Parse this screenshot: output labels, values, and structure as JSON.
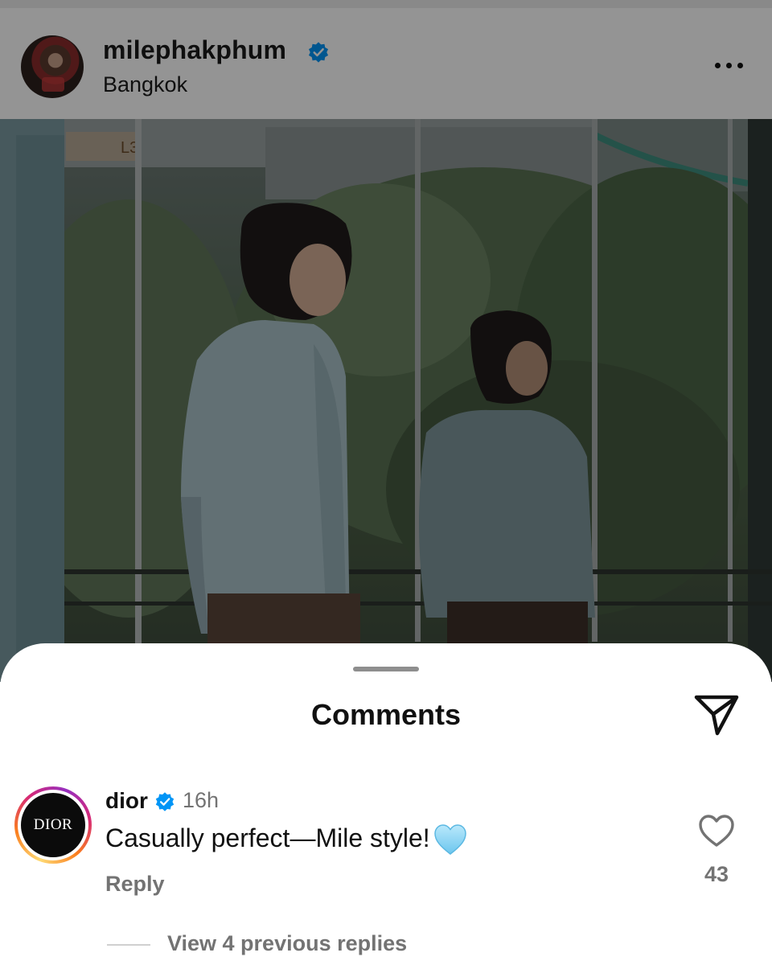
{
  "post": {
    "username": "milephakphum",
    "location": "Bangkok",
    "verified_icon": "verified-badge-icon",
    "more_icon": "more-options-icon",
    "floor_sign": "L3"
  },
  "comments_sheet": {
    "title": "Comments",
    "share_icon": "paper-plane-icon",
    "comments": [
      {
        "username": "dior",
        "avatar_text": "DIOR",
        "time": "16h",
        "text": "Casually perfect—Mile style!",
        "emoji_icon": "light-blue-heart-icon",
        "reply_label": "Reply",
        "like_icon": "heart-outline-icon",
        "like_count": "43",
        "view_replies_label": "View 4 previous replies"
      }
    ]
  },
  "colors": {
    "verified_blue": "#0095f6",
    "secondary_text": "#737373",
    "primary_text": "#111111",
    "heart_emoji": "#8fd3f4"
  }
}
